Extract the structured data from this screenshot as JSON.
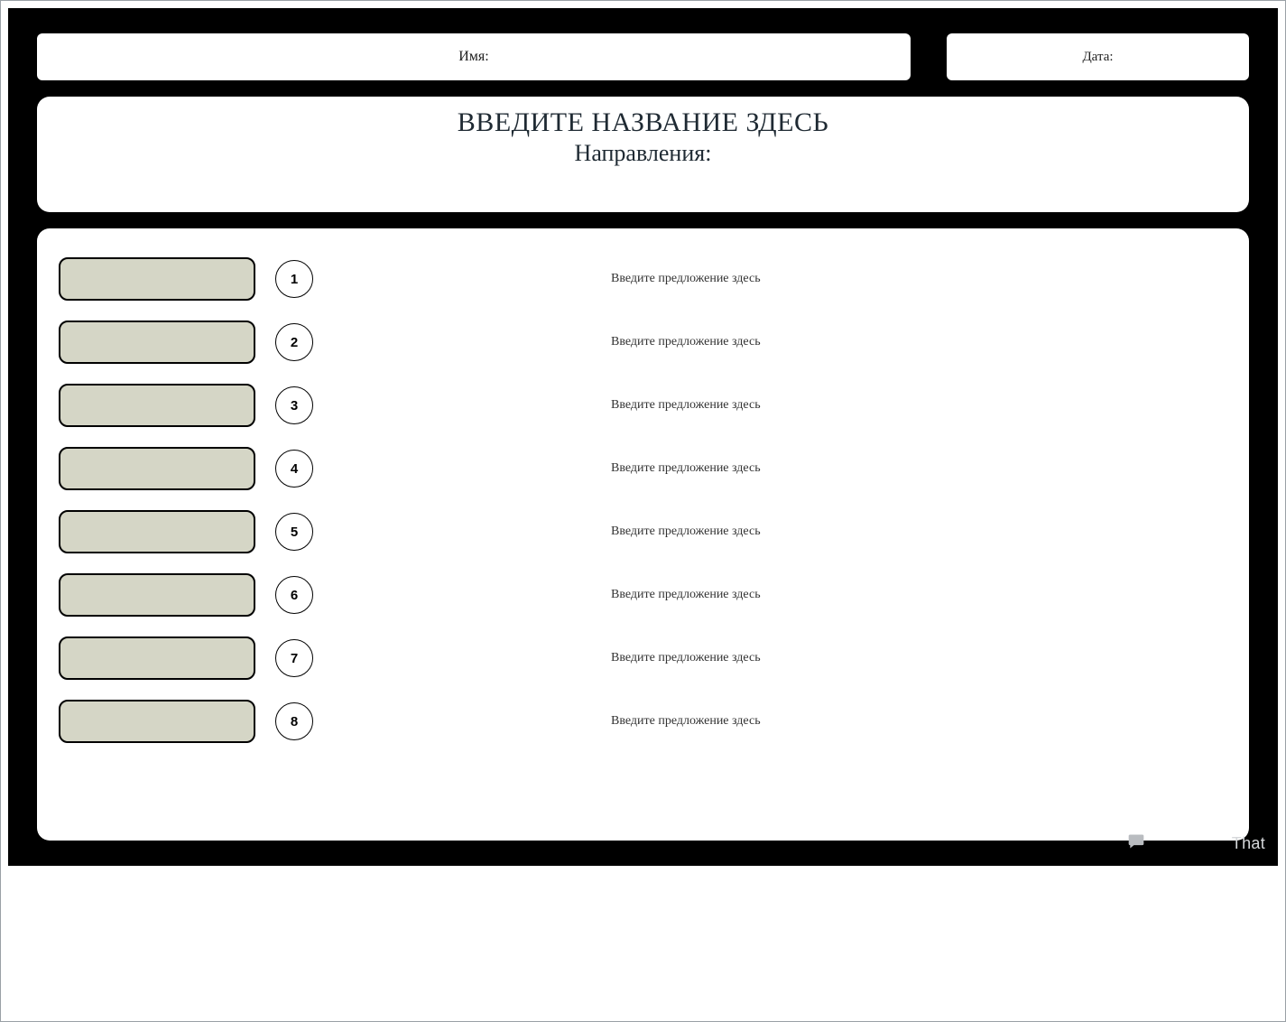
{
  "header": {
    "name_label": "Имя:",
    "date_label": "Дата:"
  },
  "title_card": {
    "title": "ВВЕДИТЕ НАЗВАНИЕ ЗДЕСЬ",
    "subtitle": "Направления:"
  },
  "rows": [
    {
      "number": "1",
      "sentence": "Введите предложение здесь"
    },
    {
      "number": "2",
      "sentence": "Введите предложение здесь"
    },
    {
      "number": "3",
      "sentence": "Введите предложение здесь"
    },
    {
      "number": "4",
      "sentence": "Введите предложение здесь"
    },
    {
      "number": "5",
      "sentence": "Введите предложение здесь"
    },
    {
      "number": "6",
      "sentence": "Введите предложение здесь"
    },
    {
      "number": "7",
      "sentence": "Введите предложение здесь"
    },
    {
      "number": "8",
      "sentence": "Введите предложение здесь"
    }
  ],
  "footer": {
    "text": "That"
  }
}
